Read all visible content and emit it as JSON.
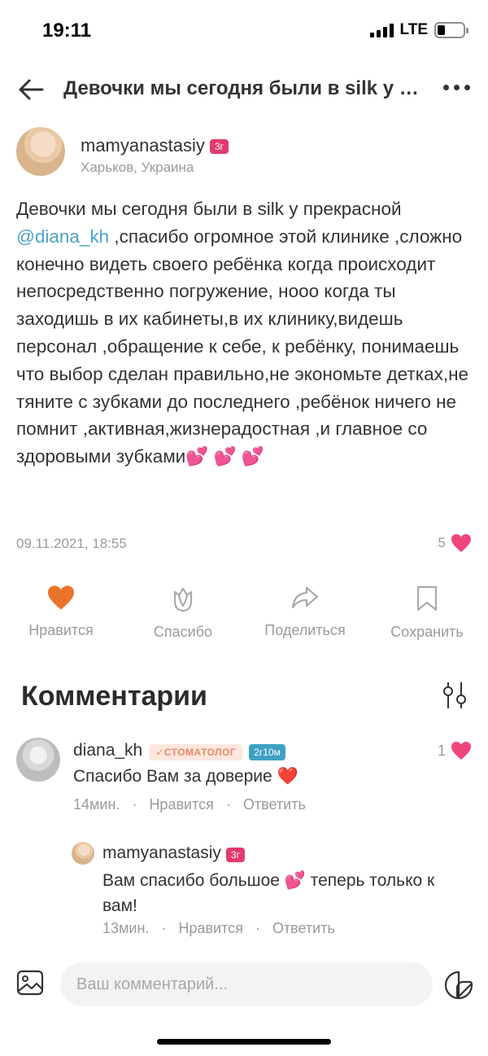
{
  "status_bar": {
    "time": "19:11",
    "network": "LTE",
    "battery_percent": 25
  },
  "nav": {
    "title": "Девочки мы сегодня были в silk у прекрасной"
  },
  "post": {
    "author": {
      "name": "mamyanastasiy",
      "badge": "3г",
      "location": "Харьков, Украина"
    },
    "text_parts": {
      "p1": "Девочки мы сегодня были в silk у прекрасной  ",
      "mention": "@diana_kh",
      "p2": " ,спасибо огромное этой клинике ,сложно конечно видеть своего ребёнка когда происходит непосредственно погружение, нооо когда ты заходишь в их кабинеты,в их клинику,видешь персонал ,обращение к себе, к ребёнку, понимаешь что выбор сделан правильно,не экономьте детках,не тяните с зубками до последнего ,ребёнок ничего не помнит  ,активная,жизнерадостная ,и главное со здоровыми зубками💕 💕 💕"
    },
    "date": "09.11.2021, 18:55",
    "likes": "5"
  },
  "actions": {
    "like": "Нравится",
    "thanks": "Спасибо",
    "share": "Поделиться",
    "save": "Сохранить"
  },
  "comments": {
    "title": "Комментарии",
    "items": [
      {
        "author": "diana_kh",
        "role": "✓СТОМАТОЛОГ",
        "tenure": "2г10м",
        "text": "Спасибо Вам за доверие ❤️",
        "time": "14мин.",
        "like_label": "Нравится",
        "reply_label": "Ответить",
        "likes": "1"
      },
      {
        "author": "mamyanastasiy",
        "badge": "3г",
        "text": "Вам спасибо большое 💕 теперь только к вам!",
        "time": "13мин.",
        "like_label": "Нравится",
        "reply_label": "Ответить"
      }
    ]
  },
  "composer": {
    "placeholder": "Ваш комментарий..."
  },
  "colors": {
    "accent": "#e9732b",
    "heart": "#f0457a",
    "link": "#4ba3c7",
    "badge_years": "#e33b6e",
    "badge_tenure": "#3fa1c4"
  }
}
